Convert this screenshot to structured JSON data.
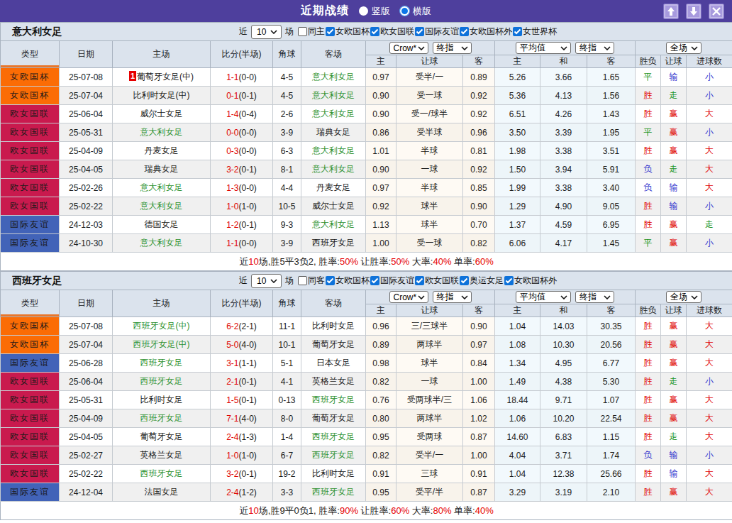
{
  "titlebar": {
    "title": "近期战绩",
    "radio_vertical": {
      "label": "竖版",
      "checked": false
    },
    "radio_horizontal": {
      "label": "横版",
      "checked": true
    },
    "buttons": {
      "up": "move-up",
      "down": "move-down",
      "close": "close"
    }
  },
  "colors": {
    "titlebar_bg": "#4e3f9d",
    "type_badge": {
      "cup": "#fb6c05",
      "league": "#c91a4e",
      "friendly": "#4263b8"
    },
    "result_text": {
      "r": "#e00000",
      "g": "#1c941c",
      "b": "#3232cd"
    },
    "team_green": "#2e9230",
    "score_red": "#e00000",
    "summary_red": "#e60000",
    "sort_underline": "#e8762b",
    "checkbox_blue": "#0e72da"
  },
  "table_header": {
    "type": "类型",
    "date": "日期",
    "home": "主场",
    "score": "比分(半场)",
    "corner": "角球",
    "away": "客场",
    "selects": {
      "bookmaker": "Crow*",
      "handicap_time": "终指",
      "average": "平均值",
      "avg_time": "终指",
      "scope": "全场"
    },
    "sub": {
      "h_home": "主",
      "h_handicap": "让球",
      "h_away": "客",
      "a_home": "主",
      "a_draw": "和",
      "a_away": "客",
      "r_wdl": "胜负",
      "r_handicap": "让球",
      "r_goals": "进球数"
    }
  },
  "sections": [
    {
      "team": "意大利女足",
      "filter": {
        "near": "近",
        "count": "10",
        "games": "场",
        "same_side": {
          "label": "同主",
          "checked": false
        },
        "competitions": [
          {
            "label": "女欧国杯",
            "checked": true
          },
          {
            "label": "欧女国联",
            "checked": true
          },
          {
            "label": "国际友谊",
            "checked": true
          },
          {
            "label": "女欧国杯外",
            "checked": true
          },
          {
            "label": "女世界杯",
            "checked": true
          }
        ]
      },
      "rows": [
        {
          "type_class": "cup",
          "date": "25-07-08",
          "home": "葡萄牙女足(中)",
          "home_green": false,
          "home_badge": "1",
          "score_ft": "1-1",
          "score_ht": "(0-0)",
          "corner": "4-5",
          "away": "意大利女足",
          "away_green": true,
          "odds_home": "0.97",
          "handicap": "受半/一",
          "odds_away": "0.89",
          "avg_home": "5.26",
          "avg_draw": "3.66",
          "avg_away": "1.65",
          "result_wdl": [
            "平",
            "g"
          ],
          "result_handicap": [
            "输",
            "b"
          ],
          "result_goals": [
            "小",
            "b"
          ],
          "type": "女欧国杯"
        },
        {
          "type_class": "cup",
          "date": "25-07-04",
          "home": "比利时女足(中)",
          "home_green": false,
          "home_badge": "",
          "score_ft": "0-1",
          "score_ht": "(0-1)",
          "corner": "4-5",
          "away": "意大利女足",
          "away_green": true,
          "odds_home": "0.90",
          "handicap": "受一球",
          "odds_away": "0.92",
          "avg_home": "5.36",
          "avg_draw": "4.13",
          "avg_away": "1.56",
          "result_wdl": [
            "胜",
            "r"
          ],
          "result_handicap": [
            "走",
            "g"
          ],
          "result_goals": [
            "小",
            "b"
          ],
          "type": "女欧国杯"
        },
        {
          "type_class": "league",
          "date": "25-06-04",
          "home": "威尔士女足",
          "home_green": false,
          "home_badge": "",
          "score_ft": "1-4",
          "score_ht": "(0-4)",
          "corner": "2-6",
          "away": "意大利女足",
          "away_green": true,
          "odds_home": "0.90",
          "handicap": "受一/球半",
          "odds_away": "0.92",
          "avg_home": "6.51",
          "avg_draw": "4.26",
          "avg_away": "1.43",
          "result_wdl": [
            "胜",
            "r"
          ],
          "result_handicap": [
            "赢",
            "r"
          ],
          "result_goals": [
            "大",
            "r"
          ],
          "type": "欧女国联"
        },
        {
          "type_class": "league",
          "date": "25-05-31",
          "home": "意大利女足",
          "home_green": true,
          "home_badge": "",
          "score_ft": "0-0",
          "score_ht": "(0-0)",
          "corner": "3-9",
          "away": "瑞典女足",
          "away_green": false,
          "odds_home": "0.86",
          "handicap": "受半球",
          "odds_away": "0.96",
          "avg_home": "3.50",
          "avg_draw": "3.39",
          "avg_away": "1.95",
          "result_wdl": [
            "平",
            "g"
          ],
          "result_handicap": [
            "赢",
            "r"
          ],
          "result_goals": [
            "小",
            "b"
          ],
          "type": "欧女国联"
        },
        {
          "type_class": "league",
          "date": "25-04-09",
          "home": "丹麦女足",
          "home_green": false,
          "home_badge": "",
          "score_ft": "0-3",
          "score_ht": "(0-0)",
          "corner": "6-3",
          "away": "意大利女足",
          "away_green": true,
          "odds_home": "1.01",
          "handicap": "半球",
          "odds_away": "0.81",
          "avg_home": "1.98",
          "avg_draw": "3.38",
          "avg_away": "3.51",
          "result_wdl": [
            "胜",
            "r"
          ],
          "result_handicap": [
            "赢",
            "r"
          ],
          "result_goals": [
            "大",
            "r"
          ],
          "type": "欧女国联"
        },
        {
          "type_class": "league",
          "date": "25-04-05",
          "home": "瑞典女足",
          "home_green": false,
          "home_badge": "",
          "score_ft": "3-2",
          "score_ht": "(0-1)",
          "corner": "8-1",
          "away": "意大利女足",
          "away_green": true,
          "odds_home": "0.90",
          "handicap": "一球",
          "odds_away": "0.92",
          "avg_home": "1.50",
          "avg_draw": "3.94",
          "avg_away": "5.91",
          "result_wdl": [
            "负",
            "b"
          ],
          "result_handicap": [
            "走",
            "g"
          ],
          "result_goals": [
            "大",
            "r"
          ],
          "type": "欧女国联"
        },
        {
          "type_class": "league",
          "date": "25-02-26",
          "home": "意大利女足",
          "home_green": true,
          "home_badge": "",
          "score_ft": "1-3",
          "score_ht": "(0-0)",
          "corner": "4-4",
          "away": "丹麦女足",
          "away_green": false,
          "odds_home": "0.97",
          "handicap": "半球",
          "odds_away": "0.85",
          "avg_home": "1.99",
          "avg_draw": "3.38",
          "avg_away": "3.40",
          "result_wdl": [
            "负",
            "b"
          ],
          "result_handicap": [
            "输",
            "b"
          ],
          "result_goals": [
            "大",
            "r"
          ],
          "type": "欧女国联"
        },
        {
          "type_class": "league",
          "date": "25-02-22",
          "home": "意大利女足",
          "home_green": true,
          "home_badge": "",
          "score_ft": "1-0",
          "score_ht": "(1-0)",
          "corner": "10-5",
          "away": "威尔士女足",
          "away_green": false,
          "odds_home": "0.92",
          "handicap": "球半",
          "odds_away": "0.90",
          "avg_home": "1.29",
          "avg_draw": "4.90",
          "avg_away": "9.05",
          "result_wdl": [
            "胜",
            "r"
          ],
          "result_handicap": [
            "输",
            "b"
          ],
          "result_goals": [
            "小",
            "b"
          ],
          "type": "欧女国联"
        },
        {
          "type_class": "friendly",
          "date": "24-12-03",
          "home": "德国女足",
          "home_green": false,
          "home_badge": "",
          "score_ft": "1-2",
          "score_ht": "(0-1)",
          "corner": "9-3",
          "away": "意大利女足",
          "away_green": true,
          "odds_home": "1.13",
          "handicap": "球半",
          "odds_away": "0.70",
          "avg_home": "1.37",
          "avg_draw": "4.59",
          "avg_away": "6.95",
          "result_wdl": [
            "胜",
            "r"
          ],
          "result_handicap": [
            "赢",
            "r"
          ],
          "result_goals": [
            "走",
            "g"
          ],
          "type": "国际友谊"
        },
        {
          "type_class": "friendly",
          "date": "24-10-30",
          "home": "意大利女足",
          "home_green": true,
          "home_badge": "",
          "score_ft": "1-1",
          "score_ht": "(0-0)",
          "corner": "3-9",
          "away": "西班牙女足",
          "away_green": false,
          "odds_home": "1.00",
          "handicap": "受一球",
          "odds_away": "0.82",
          "avg_home": "6.06",
          "avg_draw": "4.17",
          "avg_away": "1.45",
          "result_wdl": [
            "平",
            "g"
          ],
          "result_handicap": [
            "赢",
            "r"
          ],
          "result_goals": [
            "小",
            "b"
          ],
          "type": "国际友谊"
        }
      ],
      "summary": [
        [
          "近",
          "k"
        ],
        [
          "10",
          "r"
        ],
        [
          "场,胜5平3负2, 胜率:",
          "k"
        ],
        [
          "50%",
          "r"
        ],
        [
          " 让胜率:",
          "k"
        ],
        [
          "50%",
          "r"
        ],
        [
          " 大率:",
          "k"
        ],
        [
          "40%",
          "r"
        ],
        [
          " 单率:",
          "k"
        ],
        [
          "60%",
          "r"
        ]
      ]
    },
    {
      "team": "西班牙女足",
      "filter": {
        "near": "近",
        "count": "10",
        "games": "场",
        "same_side": {
          "label": "同客",
          "checked": false
        },
        "competitions": [
          {
            "label": "女欧国杯",
            "checked": true
          },
          {
            "label": "国际友谊",
            "checked": true
          },
          {
            "label": "欧女国联",
            "checked": true
          },
          {
            "label": "奥运女足",
            "checked": true
          },
          {
            "label": "女欧国杯外",
            "checked": true
          }
        ]
      },
      "rows": [
        {
          "type_class": "cup",
          "date": "25-07-08",
          "home": "西班牙女足(中)",
          "home_green": true,
          "home_badge": "",
          "score_ft": "6-2",
          "score_ht": "(2-1)",
          "corner": "11-1",
          "away": "比利时女足",
          "away_green": false,
          "odds_home": "0.96",
          "handicap": "三/三球半",
          "odds_away": "0.90",
          "avg_home": "1.04",
          "avg_draw": "14.03",
          "avg_away": "30.35",
          "result_wdl": [
            "胜",
            "r"
          ],
          "result_handicap": [
            "赢",
            "r"
          ],
          "result_goals": [
            "大",
            "r"
          ],
          "type": "女欧国杯"
        },
        {
          "type_class": "cup",
          "date": "25-07-04",
          "home": "西班牙女足(中)",
          "home_green": true,
          "home_badge": "",
          "score_ft": "5-0",
          "score_ht": "(4-0)",
          "corner": "10-1",
          "away": "葡萄牙女足",
          "away_green": false,
          "odds_home": "0.89",
          "handicap": "两球半",
          "odds_away": "0.97",
          "avg_home": "1.08",
          "avg_draw": "10.30",
          "avg_away": "20.56",
          "result_wdl": [
            "胜",
            "r"
          ],
          "result_handicap": [
            "赢",
            "r"
          ],
          "result_goals": [
            "大",
            "r"
          ],
          "type": "女欧国杯"
        },
        {
          "type_class": "friendly",
          "date": "25-06-28",
          "home": "西班牙女足",
          "home_green": true,
          "home_badge": "",
          "score_ft": "3-1",
          "score_ht": "(1-1)",
          "corner": "5-1",
          "away": "日本女足",
          "away_green": false,
          "odds_home": "0.98",
          "handicap": "球半",
          "odds_away": "0.84",
          "avg_home": "1.34",
          "avg_draw": "4.95",
          "avg_away": "6.77",
          "result_wdl": [
            "胜",
            "r"
          ],
          "result_handicap": [
            "赢",
            "r"
          ],
          "result_goals": [
            "大",
            "r"
          ],
          "type": "国际友谊"
        },
        {
          "type_class": "league",
          "date": "25-06-04",
          "home": "西班牙女足",
          "home_green": true,
          "home_badge": "",
          "score_ft": "2-1",
          "score_ht": "(0-1)",
          "corner": "4-1",
          "away": "英格兰女足",
          "away_green": false,
          "odds_home": "0.82",
          "handicap": "一球",
          "odds_away": "1.00",
          "avg_home": "1.49",
          "avg_draw": "4.38",
          "avg_away": "5.30",
          "result_wdl": [
            "胜",
            "r"
          ],
          "result_handicap": [
            "走",
            "g"
          ],
          "result_goals": [
            "小",
            "b"
          ],
          "type": "欧女国联"
        },
        {
          "type_class": "league",
          "date": "25-05-31",
          "home": "比利时女足",
          "home_green": false,
          "home_badge": "",
          "score_ft": "1-5",
          "score_ht": "(0-1)",
          "corner": "0-13",
          "away": "西班牙女足",
          "away_green": true,
          "odds_home": "0.76",
          "handicap": "受两球半/三",
          "odds_away": "1.06",
          "avg_home": "18.44",
          "avg_draw": "9.71",
          "avg_away": "1.07",
          "result_wdl": [
            "胜",
            "r"
          ],
          "result_handicap": [
            "赢",
            "r"
          ],
          "result_goals": [
            "大",
            "r"
          ],
          "type": "欧女国联"
        },
        {
          "type_class": "league",
          "date": "25-04-09",
          "home": "西班牙女足",
          "home_green": true,
          "home_badge": "",
          "score_ft": "7-1",
          "score_ht": "(4-0)",
          "corner": "8-0",
          "away": "葡萄牙女足",
          "away_green": false,
          "odds_home": "0.80",
          "handicap": "两球半",
          "odds_away": "1.02",
          "avg_home": "1.06",
          "avg_draw": "10.20",
          "avg_away": "22.54",
          "result_wdl": [
            "胜",
            "r"
          ],
          "result_handicap": [
            "赢",
            "r"
          ],
          "result_goals": [
            "大",
            "r"
          ],
          "type": "欧女国联"
        },
        {
          "type_class": "league",
          "date": "25-04-05",
          "home": "葡萄牙女足",
          "home_green": false,
          "home_badge": "",
          "score_ft": "2-4",
          "score_ht": "(1-3)",
          "corner": "1-4",
          "away": "西班牙女足",
          "away_green": true,
          "odds_home": "0.95",
          "handicap": "受两球",
          "odds_away": "0.87",
          "avg_home": "14.60",
          "avg_draw": "6.83",
          "avg_away": "1.15",
          "result_wdl": [
            "胜",
            "r"
          ],
          "result_handicap": [
            "走",
            "g"
          ],
          "result_goals": [
            "大",
            "r"
          ],
          "type": "欧女国联"
        },
        {
          "type_class": "league",
          "date": "25-02-27",
          "home": "英格兰女足",
          "home_green": false,
          "home_badge": "",
          "score_ft": "1-0",
          "score_ht": "(1-0)",
          "corner": "6-7",
          "away": "西班牙女足",
          "away_green": true,
          "odds_home": "0.82",
          "handicap": "受半/一",
          "odds_away": "1.00",
          "avg_home": "4.04",
          "avg_draw": "3.71",
          "avg_away": "1.74",
          "result_wdl": [
            "负",
            "b"
          ],
          "result_handicap": [
            "输",
            "b"
          ],
          "result_goals": [
            "小",
            "b"
          ],
          "type": "欧女国联"
        },
        {
          "type_class": "league",
          "date": "25-02-22",
          "home": "西班牙女足",
          "home_green": true,
          "home_badge": "",
          "score_ft": "3-2",
          "score_ht": "(0-1)",
          "corner": "19-2",
          "away": "比利时女足",
          "away_green": false,
          "odds_home": "0.91",
          "handicap": "三球",
          "odds_away": "0.91",
          "avg_home": "1.04",
          "avg_draw": "12.38",
          "avg_away": "25.66",
          "result_wdl": [
            "胜",
            "r"
          ],
          "result_handicap": [
            "输",
            "b"
          ],
          "result_goals": [
            "大",
            "r"
          ],
          "type": "欧女国联"
        },
        {
          "type_class": "friendly",
          "date": "24-12-04",
          "home": "法国女足",
          "home_green": false,
          "home_badge": "",
          "score_ft": "2-4",
          "score_ht": "(1-2)",
          "corner": "3-3",
          "away": "西班牙女足",
          "away_green": true,
          "odds_home": "0.95",
          "handicap": "受平/半",
          "odds_away": "0.87",
          "avg_home": "3.29",
          "avg_draw": "3.19",
          "avg_away": "2.10",
          "result_wdl": [
            "胜",
            "r"
          ],
          "result_handicap": [
            "赢",
            "r"
          ],
          "result_goals": [
            "大",
            "r"
          ],
          "type": "国际友谊"
        }
      ],
      "summary": [
        [
          "近",
          "k"
        ],
        [
          "10",
          "r"
        ],
        [
          "场,胜9平0负1, 胜率:",
          "k"
        ],
        [
          "90%",
          "r"
        ],
        [
          " 让胜率:",
          "k"
        ],
        [
          "60%",
          "r"
        ],
        [
          " 大率:",
          "k"
        ],
        [
          "80%",
          "r"
        ],
        [
          " 单率:",
          "k"
        ],
        [
          "40%",
          "r"
        ]
      ]
    }
  ]
}
